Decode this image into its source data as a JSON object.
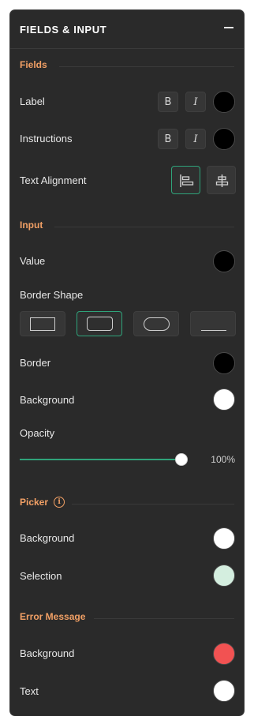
{
  "panel": {
    "title": "FIELDS & INPUT"
  },
  "fields": {
    "title": "Fields",
    "label": {
      "text": "Label",
      "bold": "B",
      "italic": "I",
      "color": "#000000"
    },
    "instructions": {
      "text": "Instructions",
      "bold": "B",
      "italic": "I",
      "color": "#000000"
    },
    "text_alignment": {
      "text": "Text Alignment",
      "options": [
        "left",
        "center"
      ],
      "selected": "left"
    }
  },
  "input": {
    "title": "Input",
    "value": {
      "text": "Value",
      "color": "#000000"
    },
    "border_shape": {
      "text": "Border Shape",
      "options": [
        "square",
        "rounded",
        "pill",
        "underline"
      ],
      "selected": "rounded"
    },
    "border": {
      "text": "Border",
      "color": "#000000"
    },
    "background": {
      "text": "Background",
      "color": "#ffffff"
    },
    "opacity": {
      "text": "Opacity",
      "value": 100,
      "display": "100%"
    }
  },
  "picker": {
    "title": "Picker",
    "info_icon": "info-icon",
    "background": {
      "text": "Background",
      "color": "#ffffff"
    },
    "selection": {
      "text": "Selection",
      "color": "#d4eedf"
    }
  },
  "error_message": {
    "title": "Error Message",
    "background": {
      "text": "Background",
      "color": "#f25252"
    },
    "text": {
      "text": "Text",
      "color": "#ffffff"
    }
  },
  "accent": "#2fa37a",
  "section_color": "#f2a065"
}
